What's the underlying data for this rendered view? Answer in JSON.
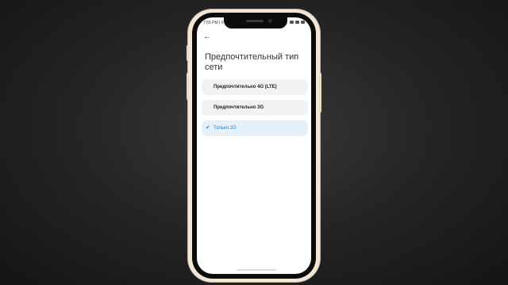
{
  "status_bar": {
    "time": "7:55 PM | 0"
  },
  "screen": {
    "title": "Предпочтительный тип сети",
    "back_icon": "back-arrow-icon",
    "options": [
      {
        "label": "Предпочтительно 4G (LTE)",
        "selected": false
      },
      {
        "label": "Предпочтительно 3G",
        "selected": false
      },
      {
        "label": "Только 2G",
        "selected": true
      }
    ]
  },
  "colors": {
    "accent": "#1c7fc4",
    "phone_frame": "#f3e6d6",
    "option_bg": "#f2f2f2",
    "selected_bg": "#e6f0f9"
  }
}
